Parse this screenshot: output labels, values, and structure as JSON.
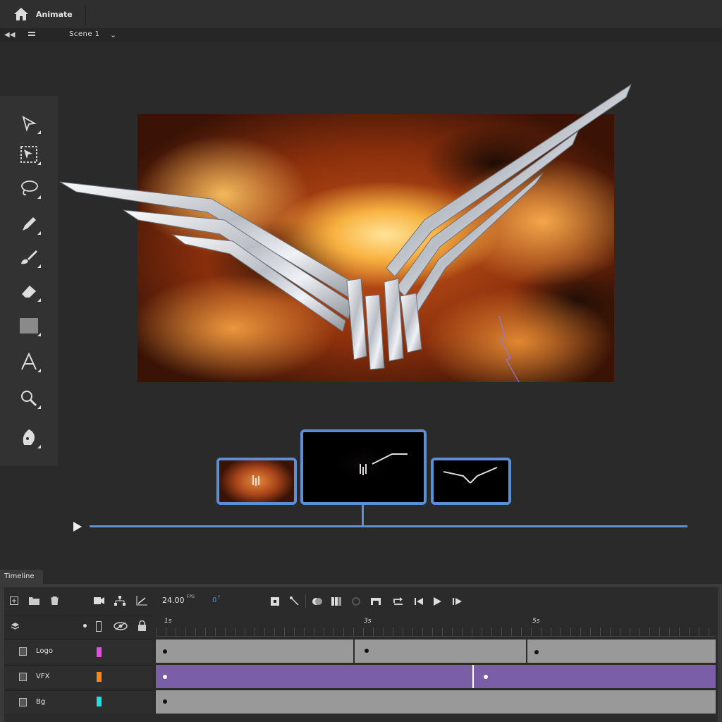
{
  "app": {
    "title": "Animate",
    "home_icon": "home-icon"
  },
  "scene": {
    "name": "Scene 1"
  },
  "tools": [
    {
      "name": "selection-tool",
      "icon": "arrow-cursor-icon"
    },
    {
      "name": "subselection-tool",
      "icon": "subselect-icon"
    },
    {
      "name": "lasso-tool",
      "icon": "lasso-icon"
    },
    {
      "name": "pencil-tool",
      "icon": "pencil-icon"
    },
    {
      "name": "brush-tool",
      "icon": "brush-icon"
    },
    {
      "name": "eraser-tool",
      "icon": "eraser-icon"
    },
    {
      "name": "rectangle-tool",
      "icon": "rectangle-icon"
    },
    {
      "name": "text-tool",
      "icon": "text-icon"
    },
    {
      "name": "zoom-tool",
      "icon": "magnifier-icon"
    },
    {
      "name": "pen-tool",
      "icon": "pen-icon"
    }
  ],
  "timeline": {
    "tab_label": "Timeline",
    "fps": "24.00",
    "fps_unit": "FPS",
    "current_frame": "0",
    "frame_unit": "F",
    "ruler": [
      {
        "label": "1s"
      },
      {
        "label": "3s"
      },
      {
        "label": "5s"
      }
    ],
    "layers": [
      {
        "name": "Logo",
        "color": "#e44ee0"
      },
      {
        "name": "VFX",
        "color": "#f08a1e"
      },
      {
        "name": "Bg",
        "color": "#1ee0e0"
      }
    ]
  },
  "colors": {
    "accent": "#5b8fd6",
    "tween": "#7b5ea8",
    "frames": "#999999"
  }
}
